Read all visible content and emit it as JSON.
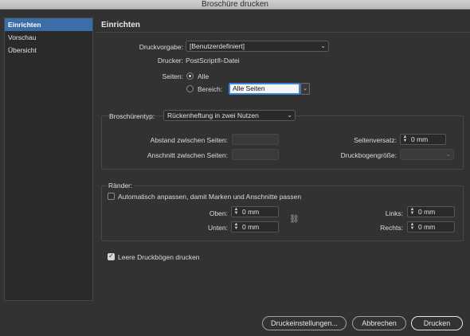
{
  "window": {
    "title": "Broschüre drucken"
  },
  "sidebar": {
    "items": [
      {
        "label": "Einrichten",
        "active": true
      },
      {
        "label": "Vorschau",
        "active": false
      },
      {
        "label": "Übersicht",
        "active": false
      }
    ]
  },
  "main": {
    "title": "Einrichten",
    "print_preset": {
      "label": "Druckvorgabe:",
      "value": "[Benutzerdefiniert]"
    },
    "printer": {
      "label": "Drucker:",
      "value": "PostScript®-Datei"
    },
    "pages": {
      "label": "Seiten:",
      "option_all": "Alle",
      "option_range": "Bereich:",
      "selected": "Alle",
      "range_value": "Alle Seiten"
    }
  },
  "booklet": {
    "type_label": "Broschürentyp:",
    "type_value": "Rückenheftung in zwei Nutzen",
    "space_between_label": "Abstand zwischen Seiten:",
    "bleed_between_label": "Anschnitt zwischen Seiten:",
    "creep_label": "Seitenversatz:",
    "creep_value": "0 mm",
    "signature_size_label": "Druckbogengröße:"
  },
  "margins": {
    "title": "Ränder:",
    "auto_fit_label": "Automatisch anpassen, damit Marken und Anschnitte passen",
    "auto_fit_checked": false,
    "top_label": "Oben:",
    "top_value": "0 mm",
    "bottom_label": "Unten:",
    "bottom_value": "0 mm",
    "left_label": "Links:",
    "left_value": "0 mm",
    "right_label": "Rechts:",
    "right_value": "0 mm"
  },
  "blank_spreads": {
    "label": "Leere Druckbögen drucken",
    "checked": true
  },
  "buttons": {
    "print_settings": "Druckeinstellungen...",
    "cancel": "Abbrechen",
    "print": "Drucken"
  },
  "icons": {
    "select_chevron": "chevron-down-icon",
    "spinner": "stepper-icon",
    "chain": "chain-link-icon"
  }
}
